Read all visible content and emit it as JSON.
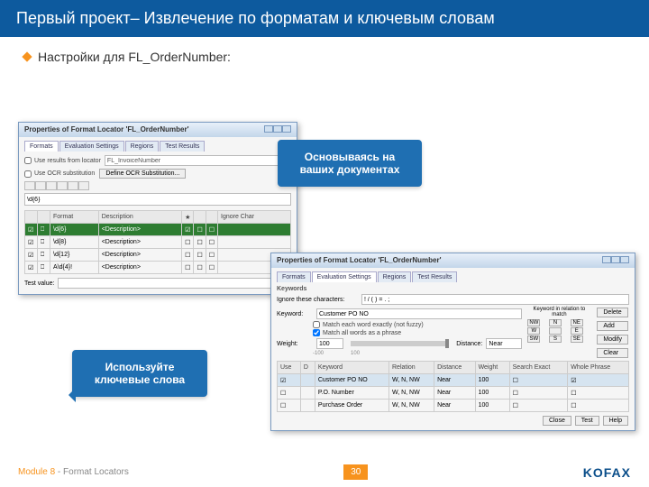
{
  "slide": {
    "title": "Первый проект– Извлечение по форматам и ключевым словам",
    "bullet": "Настройки для FL_OrderNumber:",
    "module_prefix": "Module 8",
    "module_suffix": " - Format Locators",
    "number": "30",
    "logo": "KOFAX"
  },
  "callouts": {
    "top": "Основываясь на ваших документах",
    "bottom": "Используйте ключевые слова"
  },
  "dialog1": {
    "title": "Properties of Format Locator 'FL_OrderNumber'",
    "tabs": [
      "Formats",
      "Evaluation Settings",
      "Regions",
      "Test Results"
    ],
    "chk1": "Use results from locator",
    "chk2": "Use OCR substitution",
    "locator": "FL_InvoiceNumber",
    "btn_ocr": "Define OCR Substitution...",
    "regex": "\\d{6}",
    "headers": [
      "",
      "",
      "Format",
      "Description",
      "",
      "",
      "",
      "Ignore Char"
    ],
    "rows": [
      {
        "sel": true,
        "fmt": "\\d{6}",
        "desc": "<Description>"
      },
      {
        "sel": false,
        "fmt": "\\d{8}",
        "desc": "<Description>"
      },
      {
        "sel": false,
        "fmt": "\\d{12}",
        "desc": "<Description>"
      },
      {
        "sel": false,
        "fmt": "A\\d{4}!",
        "desc": "<Description>"
      }
    ],
    "testlabel": "Test value:"
  },
  "dialog2": {
    "title": "Properties of Format Locator 'FL_OrderNumber'",
    "tabs": [
      "Formats",
      "Evaluation Settings",
      "Regions",
      "Test Results"
    ],
    "active_tab": 1,
    "keywords_label": "Keywords",
    "ignore_label": "Ignore these characters:",
    "ignore_value": "! / ( ) = . ;",
    "keyword_label": "Keyword:",
    "keyword_value": "Customer PO NO",
    "chk_exact": "Match each word exactly (not fuzzy)",
    "chk_phrase": "Match all words as a phrase",
    "weight_label": "Weight:",
    "weight_value": "100",
    "distance_label": "Distance:",
    "distance_value": "Near",
    "rel_label": "Keyword in relation to match",
    "buttons": {
      "delete": "Delete",
      "add": "Add",
      "modify": "Modify",
      "clear": "Clear"
    },
    "relgrid": [
      "NW",
      "N",
      "NE",
      "W",
      "",
      "E",
      "SW",
      "S",
      "SE"
    ],
    "table": {
      "headers": [
        "Use",
        "D",
        "Keyword",
        "Relation",
        "Distance",
        "Weight",
        "Search Exact",
        "Whole Phrase"
      ],
      "rows": [
        {
          "use": true,
          "d": "",
          "kw": "Customer PO NO",
          "rel": "W, N, NW",
          "dist": "Near",
          "wt": "100",
          "se": false,
          "wp": true
        },
        {
          "use": false,
          "d": "",
          "kw": "P.O. Number",
          "rel": "W, N, NW",
          "dist": "Near",
          "wt": "100",
          "se": false,
          "wp": false
        },
        {
          "use": false,
          "d": "",
          "kw": "Purchase Order",
          "rel": "W, N, NW",
          "dist": "Near",
          "wt": "100",
          "se": false,
          "wp": false
        }
      ]
    },
    "footer_buttons": [
      "Close",
      "Test",
      "Help"
    ]
  }
}
